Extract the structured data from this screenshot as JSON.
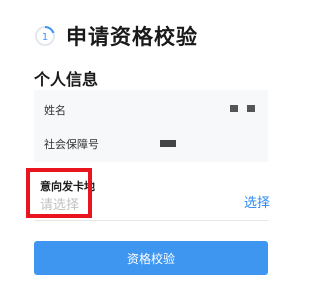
{
  "header": {
    "title": "申请资格校验",
    "step_icon": "step-indicator-icon"
  },
  "section": {
    "title": "个人信息"
  },
  "personal_info": {
    "name_label": "姓名",
    "ssn_label": "社会保障号"
  },
  "card_region": {
    "label": "意向发卡地",
    "placeholder": "请选择",
    "select_label": "选择"
  },
  "submit": {
    "label": "资格校验"
  },
  "colors": {
    "accent": "#3f96f1",
    "link": "#2b8af0",
    "highlight": "#e8141e"
  }
}
